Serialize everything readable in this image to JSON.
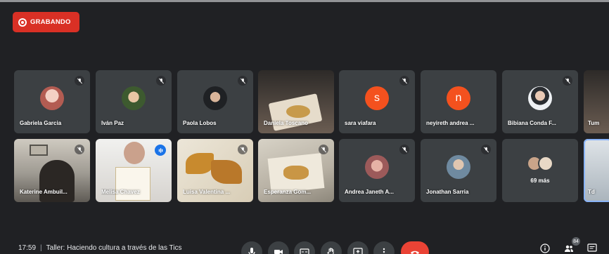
{
  "recording": {
    "label": "GRABANDO",
    "color": "#d93025"
  },
  "participants_row1": [
    {
      "name": "Gabriela Garcia",
      "muted": true,
      "avatar_color": "#c98f80"
    },
    {
      "name": "Iván Paz",
      "muted": true,
      "avatar_color": "#6f8f5a"
    },
    {
      "name": "Paola Lobos",
      "muted": true,
      "avatar_color": "#2e3236"
    },
    {
      "name": "Daniela Toscano",
      "muted": false,
      "video": true
    },
    {
      "name": "sara viafara",
      "muted": true,
      "letter": "s",
      "letter_color": "#f4511e"
    },
    {
      "name": "neyireth andrea ...",
      "muted": false,
      "letter": "n",
      "letter_color": "#f4511e"
    },
    {
      "name": "Bibiana Conda F...",
      "muted": true,
      "avatar_color": "#dde3ea"
    },
    {
      "name": "Tum",
      "muted": false,
      "video": true
    }
  ],
  "participants_row2": [
    {
      "name": "Katerine Ambuil...",
      "muted": true,
      "video": true
    },
    {
      "name": "Melisa Chavez",
      "muted": false,
      "speaking": true,
      "video": true
    },
    {
      "name": "Luisa Valentina ...",
      "muted": true,
      "video": true
    },
    {
      "name": "Esperanza Gom...",
      "muted": true,
      "video": true
    },
    {
      "name": "Andrea Janeth A...",
      "muted": true,
      "avatar_color": "#b86e6e"
    },
    {
      "name": "Jonathan Sarria",
      "muted": true,
      "avatar_color": "#8fa6b8"
    },
    {
      "more_label": "69 más"
    },
    {
      "name": "Td",
      "video": true,
      "active": true
    }
  ],
  "meeting": {
    "time": "17:59",
    "title": "Taller: Haciendo cultura a través de las Tics"
  },
  "controls": {
    "icons": [
      "microphone-icon",
      "camera-icon",
      "captions-icon",
      "raise-hand-icon",
      "present-icon",
      "more-options-icon",
      "hang-up-icon"
    ],
    "hangup_color": "#ea4335"
  },
  "side": {
    "people_count": "84",
    "icons": [
      "info-icon",
      "people-icon",
      "chat-icon"
    ]
  }
}
